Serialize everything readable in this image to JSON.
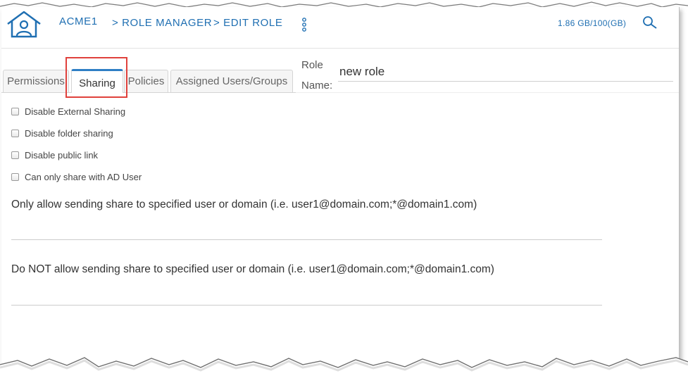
{
  "header": {
    "org": "ACME1",
    "breadcrumbs": [
      "> ROLE MANAGER",
      "> EDIT ROLE"
    ],
    "storage": "1.86 GB/100(GB)",
    "home_icon": "home-user-icon",
    "search_icon": "search-icon",
    "menu_icon": "kebab-menu-icon"
  },
  "tabs": [
    {
      "label": "Permissions",
      "active": false
    },
    {
      "label": "Sharing",
      "active": true
    },
    {
      "label": "Policies",
      "active": false
    },
    {
      "label": "Assigned Users/Groups",
      "active": false
    }
  ],
  "role": {
    "label_line1": "Role",
    "label_line2": "Name:",
    "value": "new role"
  },
  "sharing_options": [
    {
      "label": "Disable External Sharing",
      "checked": false
    },
    {
      "label": "Disable folder sharing",
      "checked": false
    },
    {
      "label": "Disable public link",
      "checked": false
    },
    {
      "label": "Can only share with AD User",
      "checked": false
    }
  ],
  "allow_rule": {
    "label": "Only allow sending share to specified user or domain (i.e. user1@domain.com;*@domain1.com)",
    "value": ""
  },
  "deny_rule": {
    "label": "Do NOT allow sending share to specified user or domain (i.e. user1@domain.com;*@domain1.com)",
    "value": ""
  },
  "colors": {
    "accent": "#1f6fb2",
    "highlight": "#e0413c"
  }
}
